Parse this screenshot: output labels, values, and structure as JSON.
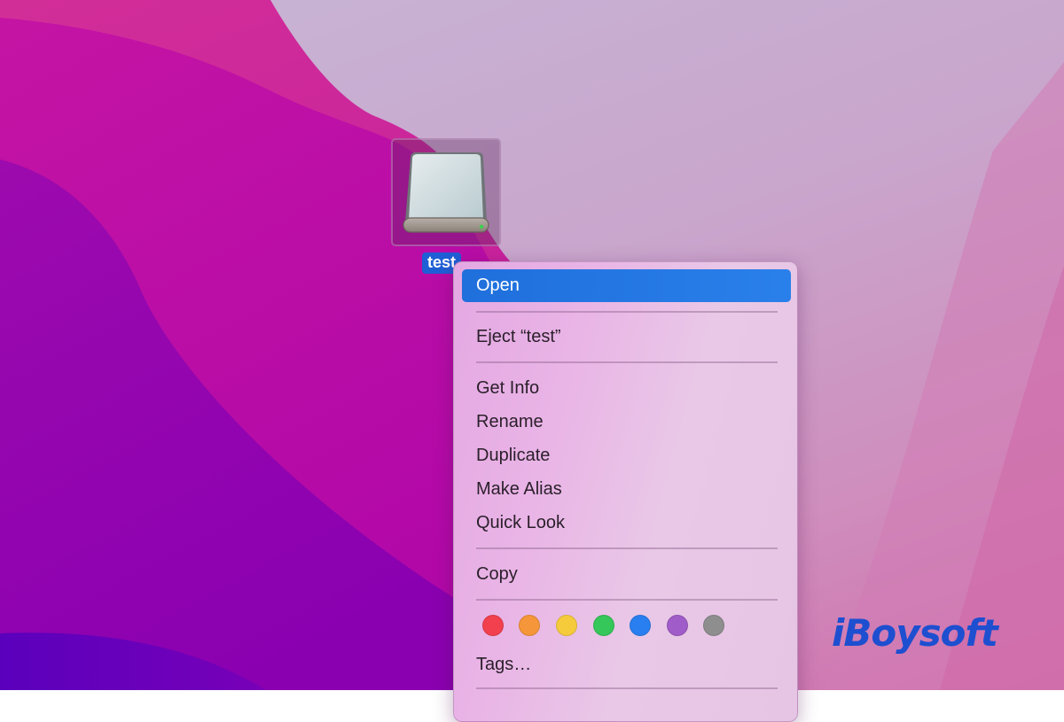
{
  "desktop": {
    "icon": {
      "name": "test",
      "type": "external-drive-icon"
    }
  },
  "context_menu": {
    "items": [
      {
        "label": "Open",
        "highlighted": true
      },
      {
        "label": "Eject “test”"
      },
      {
        "label": "Get Info"
      },
      {
        "label": "Rename"
      },
      {
        "label": "Duplicate"
      },
      {
        "label": "Make Alias"
      },
      {
        "label": "Quick Look"
      },
      {
        "label": "Copy"
      },
      {
        "label": "Tags…"
      }
    ],
    "tag_colors": [
      {
        "name": "red",
        "color": "#f2404f"
      },
      {
        "name": "orange",
        "color": "#f5963a"
      },
      {
        "name": "yellow",
        "color": "#f5cb3c"
      },
      {
        "name": "green",
        "color": "#35c759"
      },
      {
        "name": "blue",
        "color": "#2a7ff0"
      },
      {
        "name": "purple",
        "color": "#a05cc8"
      },
      {
        "name": "gray",
        "color": "#8e8e8e"
      }
    ]
  },
  "watermark": {
    "text": "iBoysoft",
    "color": "#1d4fd0"
  },
  "colors": {
    "highlight": "#2a80ea",
    "selection_label": "#1f5fd6"
  }
}
